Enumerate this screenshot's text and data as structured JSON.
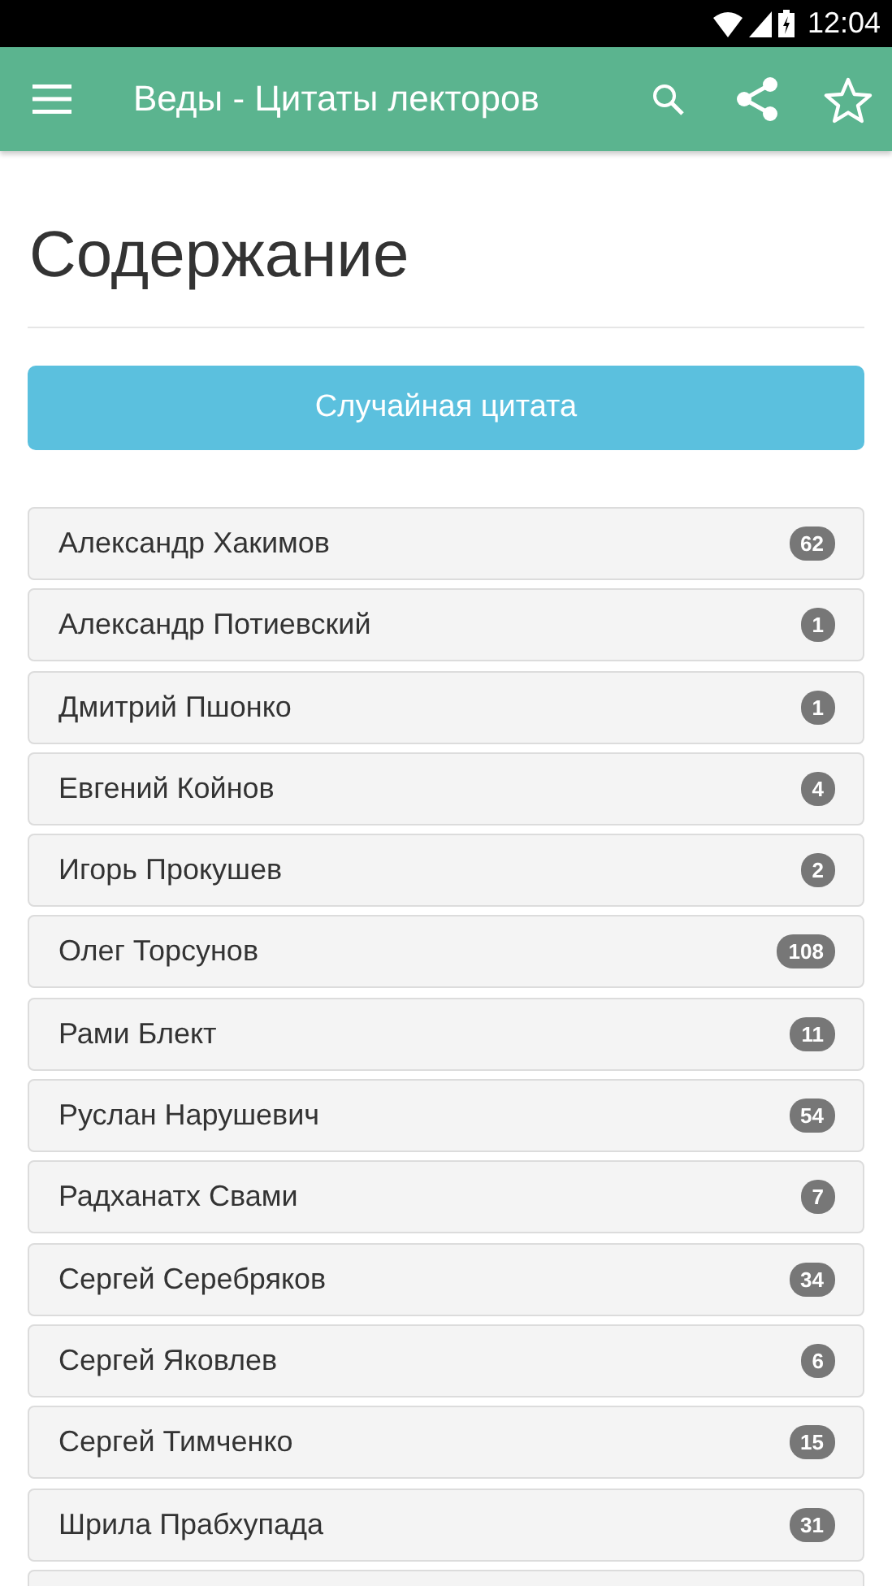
{
  "status_bar": {
    "time": "12:04"
  },
  "app_bar": {
    "title": "Веды - Цитаты лекторов"
  },
  "heading": "Содержание",
  "random_button": "Случайная цитата",
  "lecturers": [
    {
      "name": "Александр Хакимов",
      "count": "62"
    },
    {
      "name": "Александр Потиевский",
      "count": "1"
    },
    {
      "name": "Дмитрий Пшонко",
      "count": "1"
    },
    {
      "name": "Евгений Койнов",
      "count": "4"
    },
    {
      "name": "Игорь Прокушев",
      "count": "2"
    },
    {
      "name": "Олег Торсунов",
      "count": "108"
    },
    {
      "name": "Рами Блект",
      "count": "11"
    },
    {
      "name": "Руслан Нарушевич",
      "count": "54"
    },
    {
      "name": "Радханатх Свами",
      "count": "7"
    },
    {
      "name": "Сергей Серебряков",
      "count": "34"
    },
    {
      "name": "Сергей Яковлев",
      "count": "6"
    },
    {
      "name": "Сергей Тимченко",
      "count": "15"
    },
    {
      "name": "Шрила Прабхупада",
      "count": "31"
    }
  ]
}
